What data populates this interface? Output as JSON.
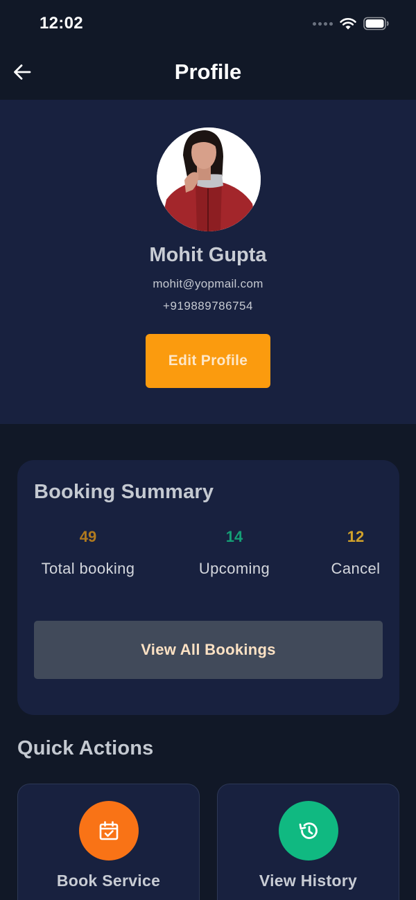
{
  "status_bar": {
    "time": "12:02",
    "icons": [
      "signal-dots-icon",
      "wifi-icon",
      "battery-icon"
    ]
  },
  "header": {
    "title": "Profile",
    "back_icon": "arrow-left-icon"
  },
  "profile": {
    "name": "Mohit Gupta",
    "email": "mohit@yopmail.com",
    "phone": "+919889786754",
    "edit_label": "Edit Profile"
  },
  "booking_summary": {
    "title": "Booking Summary",
    "stats": [
      {
        "value": "49",
        "label": "Total booking",
        "color": "#b07a1f"
      },
      {
        "value": "14",
        "label": "Upcoming",
        "color": "#149f76"
      },
      {
        "value": "12",
        "label": "Cancel",
        "color": "#d2a22a"
      }
    ],
    "view_all_label": "View All Bookings"
  },
  "quick_actions": {
    "title": "Quick Actions",
    "items": [
      {
        "label": "Book Service",
        "icon": "calendar-check-icon",
        "color": "#f97316"
      },
      {
        "label": "View History",
        "icon": "history-icon",
        "color": "#10b981"
      }
    ]
  },
  "colors": {
    "background": "#111827",
    "card": "#18213f",
    "accent_orange": "#fb9b0e",
    "button_gray": "#414a5a"
  }
}
